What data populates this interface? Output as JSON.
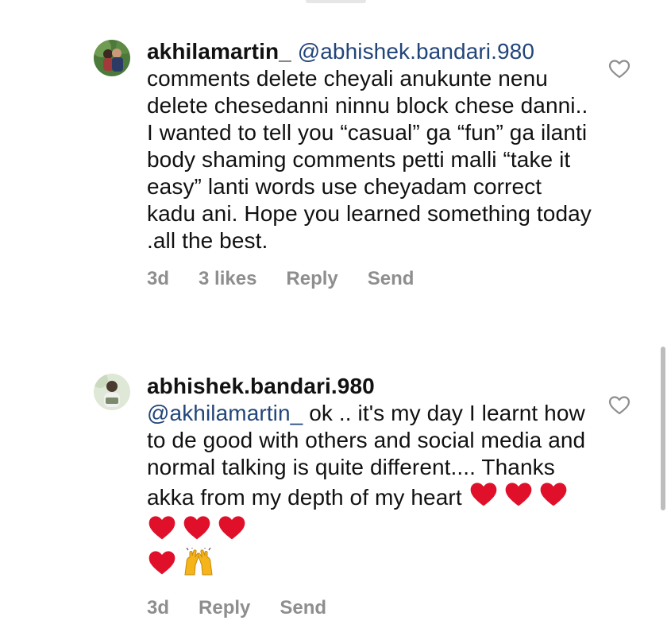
{
  "comments": [
    {
      "username": "akhilamartin_",
      "mention": "@abhishek.bandari.980",
      "text": "comments delete cheyali anukunte nenu delete chesedanni ninnu block chese danni.. I wanted to tell you “casual” ga “fun” ga ilanti body shaming comments petti malli “take it easy” lanti words use cheyadam correct kadu ani. Hope you learned something today .all the best.",
      "time": "3d",
      "likes": "3 likes",
      "reply": "Reply",
      "send": "Send"
    },
    {
      "username": "abhishek.bandari.980",
      "mention": "@akhilamartin_",
      "text": " ok .. it's my day I learnt how to de good with others and social media and normal talking is quite different.... Thanks akka from my depth of my heart",
      "time": "3d",
      "reply": "Reply",
      "send": "Send"
    }
  ],
  "icons": {
    "like": "heart-outline-icon",
    "emoji_heart": "red-heart-emoji",
    "emoji_hands": "raising-hands-emoji"
  },
  "colors": {
    "mention": "#22457a",
    "meta": "#8e8e8e",
    "heart_emoji": "#e0102b",
    "hands_emoji": "#f4b41a"
  }
}
